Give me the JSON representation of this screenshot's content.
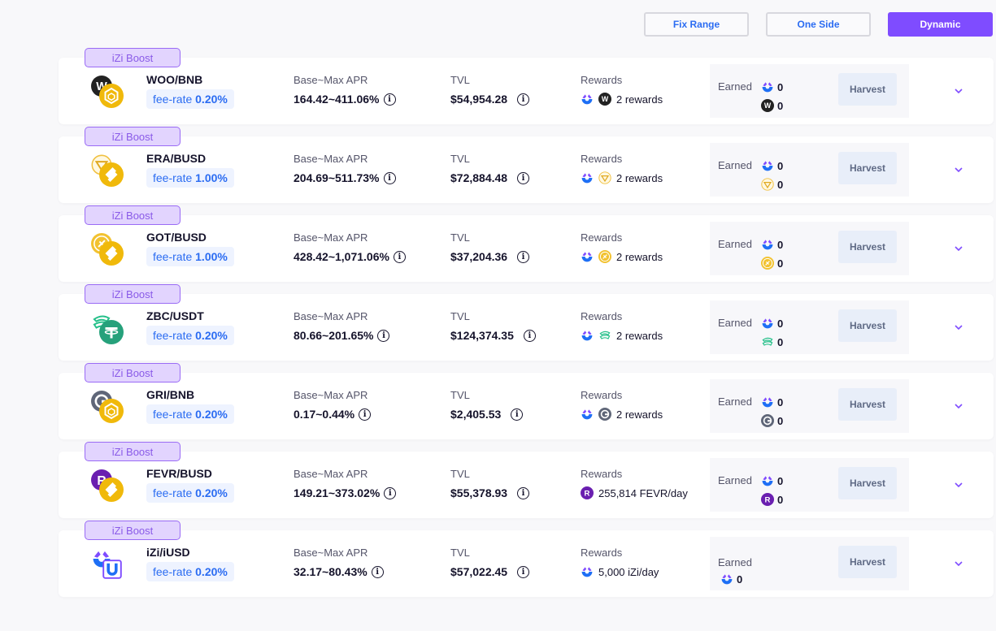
{
  "mode_tabs": [
    {
      "label": "Fix Range",
      "active": false
    },
    {
      "label": "One Side",
      "active": false
    },
    {
      "label": "Dynamic",
      "active": true
    }
  ],
  "labels": {
    "boost": "iZi Boost",
    "fee_prefix": "fee-rate",
    "apr": "Base~Max APR",
    "tvl": "TVL",
    "rewards": "Rewards",
    "earned": "Earned",
    "harvest": "Harvest"
  },
  "pools": [
    {
      "pair": "WOO/BNB",
      "token_a": "woo-icon",
      "token_b": "bnb-icon",
      "fee": "0.20%",
      "apr": "164.42~411.06%",
      "tvl": "$54,954.28",
      "reward_icons": [
        "izi-icon",
        "woo-icon"
      ],
      "rewards": "2 rewards",
      "earned": [
        {
          "icon": "izi-icon",
          "value": "0"
        },
        {
          "icon": "woo-icon",
          "value": "0"
        }
      ]
    },
    {
      "pair": "ERA/BUSD",
      "token_a": "era-icon",
      "token_b": "busd-icon",
      "fee": "1.00%",
      "apr": "204.69~511.73%",
      "tvl": "$72,884.48",
      "reward_icons": [
        "izi-icon",
        "era-icon"
      ],
      "rewards": "2 rewards",
      "earned": [
        {
          "icon": "izi-icon",
          "value": "0"
        },
        {
          "icon": "era-icon",
          "value": "0"
        }
      ]
    },
    {
      "pair": "GOT/BUSD",
      "token_a": "got-icon",
      "token_b": "busd-icon",
      "fee": "1.00%",
      "apr": "428.42~1,071.06%",
      "tvl": "$37,204.36",
      "reward_icons": [
        "izi-icon",
        "got-icon"
      ],
      "rewards": "2 rewards",
      "earned": [
        {
          "icon": "izi-icon",
          "value": "0"
        },
        {
          "icon": "got-icon",
          "value": "0"
        }
      ]
    },
    {
      "pair": "ZBC/USDT",
      "token_a": "zbc-icon",
      "token_b": "usdt-icon",
      "fee": "0.20%",
      "apr": "80.66~201.65%",
      "tvl": "$124,374.35",
      "reward_icons": [
        "izi-icon",
        "zbc-icon"
      ],
      "rewards": "2 rewards",
      "earned": [
        {
          "icon": "izi-icon",
          "value": "0"
        },
        {
          "icon": "zbc-icon",
          "value": "0"
        }
      ]
    },
    {
      "pair": "GRI/BNB",
      "token_a": "gri-icon",
      "token_b": "bnb-icon",
      "fee": "0.20%",
      "apr": "0.17~0.44%",
      "tvl": "$2,405.53",
      "reward_icons": [
        "izi-icon",
        "gri-icon"
      ],
      "rewards": "2 rewards",
      "earned": [
        {
          "icon": "izi-icon",
          "value": "0"
        },
        {
          "icon": "gri-icon",
          "value": "0"
        }
      ]
    },
    {
      "pair": "FEVR/BUSD",
      "token_a": "fevr-icon",
      "token_b": "busd-icon",
      "fee": "0.20%",
      "apr": "149.21~373.02%",
      "tvl": "$55,378.93",
      "reward_icons": [
        "fevr-icon"
      ],
      "rewards": "255,814 FEVR/day",
      "earned": [
        {
          "icon": "izi-icon",
          "value": "0"
        },
        {
          "icon": "fevr-icon",
          "value": "0"
        }
      ]
    },
    {
      "pair": "iZi/iUSD",
      "token_a": "izi-icon",
      "token_b": "iusd-icon",
      "fee": "0.20%",
      "apr": "32.17~80.43%",
      "tvl": "$57,022.45",
      "reward_icons": [
        "izi-icon"
      ],
      "rewards": "5,000 iZi/day",
      "earned": [
        {
          "icon": "izi-icon",
          "value": "0"
        }
      ]
    }
  ],
  "colors": {
    "accent": "#7f4cff",
    "link_blue": "#2b6cf2",
    "boost_bg": "#e2d4fe",
    "boost_border": "#9a6bf5"
  }
}
